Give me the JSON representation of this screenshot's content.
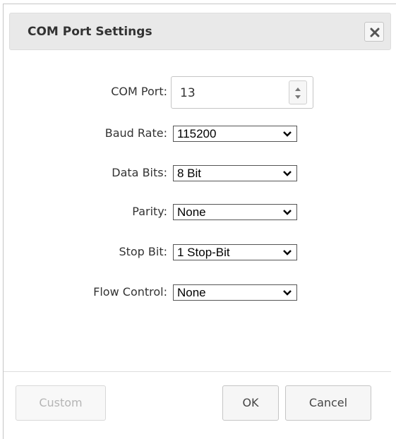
{
  "dialog": {
    "title": "COM Port Settings",
    "close_icon": "close-icon"
  },
  "fields": {
    "com_port": {
      "label": "COM Port:",
      "value": "13"
    },
    "baud_rate": {
      "label": "Baud Rate:",
      "value": "115200"
    },
    "data_bits": {
      "label": "Data Bits:",
      "value": "8 Bit"
    },
    "parity": {
      "label": "Parity:",
      "value": "None"
    },
    "stop_bit": {
      "label": "Stop Bit:",
      "value": "1 Stop-Bit"
    },
    "flow_control": {
      "label": "Flow Control:",
      "value": "None"
    }
  },
  "buttons": {
    "custom": "Custom",
    "ok": "OK",
    "cancel": "Cancel"
  },
  "colors": {
    "titlebar_bg": "#e9e9e9",
    "text": "#333333",
    "border": "#c5c5c5"
  }
}
